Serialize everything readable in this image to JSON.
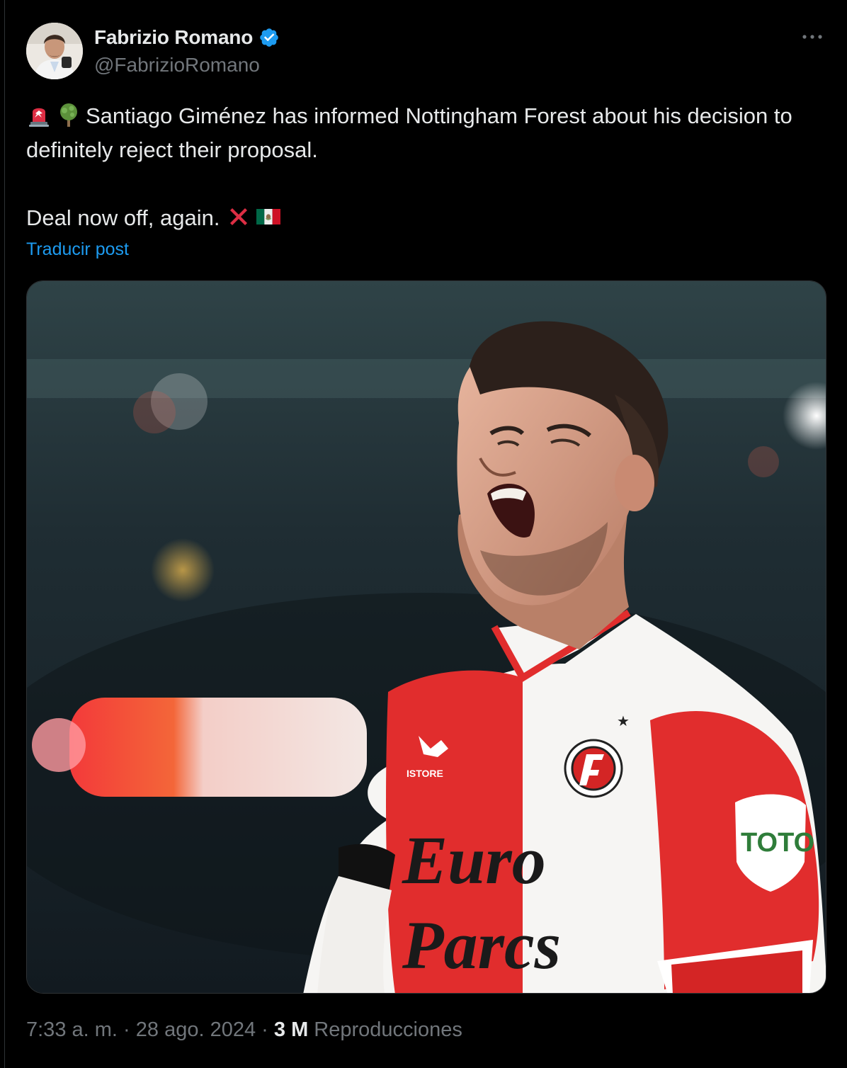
{
  "author": {
    "display_name": "Fabrizio Romano",
    "handle": "@FabrizioRomano",
    "verified": true,
    "avatar_icon": "profile-photo"
  },
  "tweet": {
    "emoji_lead": [
      "police-light-emoji",
      "tree-emoji"
    ],
    "line1": "Santiago Giménez has informed Nottingham Forest about his decision to definitely reject their proposal.",
    "line2": "Deal now off, again.",
    "emoji_trail": [
      "cross-mark-emoji",
      "mexico-flag-emoji"
    ],
    "translate_label": "Traducir post"
  },
  "media": {
    "kind": "photo",
    "jersey_sponsor": "Euro Parcs",
    "sleeve_patch": "TOTO",
    "kit_brand": "ISTORE",
    "club_crest": "FEYENOORD ROTTERDAM"
  },
  "meta": {
    "time": "7:33 a. m.",
    "date": "28 ago. 2024",
    "views_count": "3 M",
    "views_label": "Reproducciones",
    "separator": "·"
  },
  "colors": {
    "background": "#000000",
    "text_primary": "#e7e9ea",
    "text_secondary": "#71767b",
    "link": "#1d9bf0",
    "verified_badge": "#1d9bf0"
  }
}
